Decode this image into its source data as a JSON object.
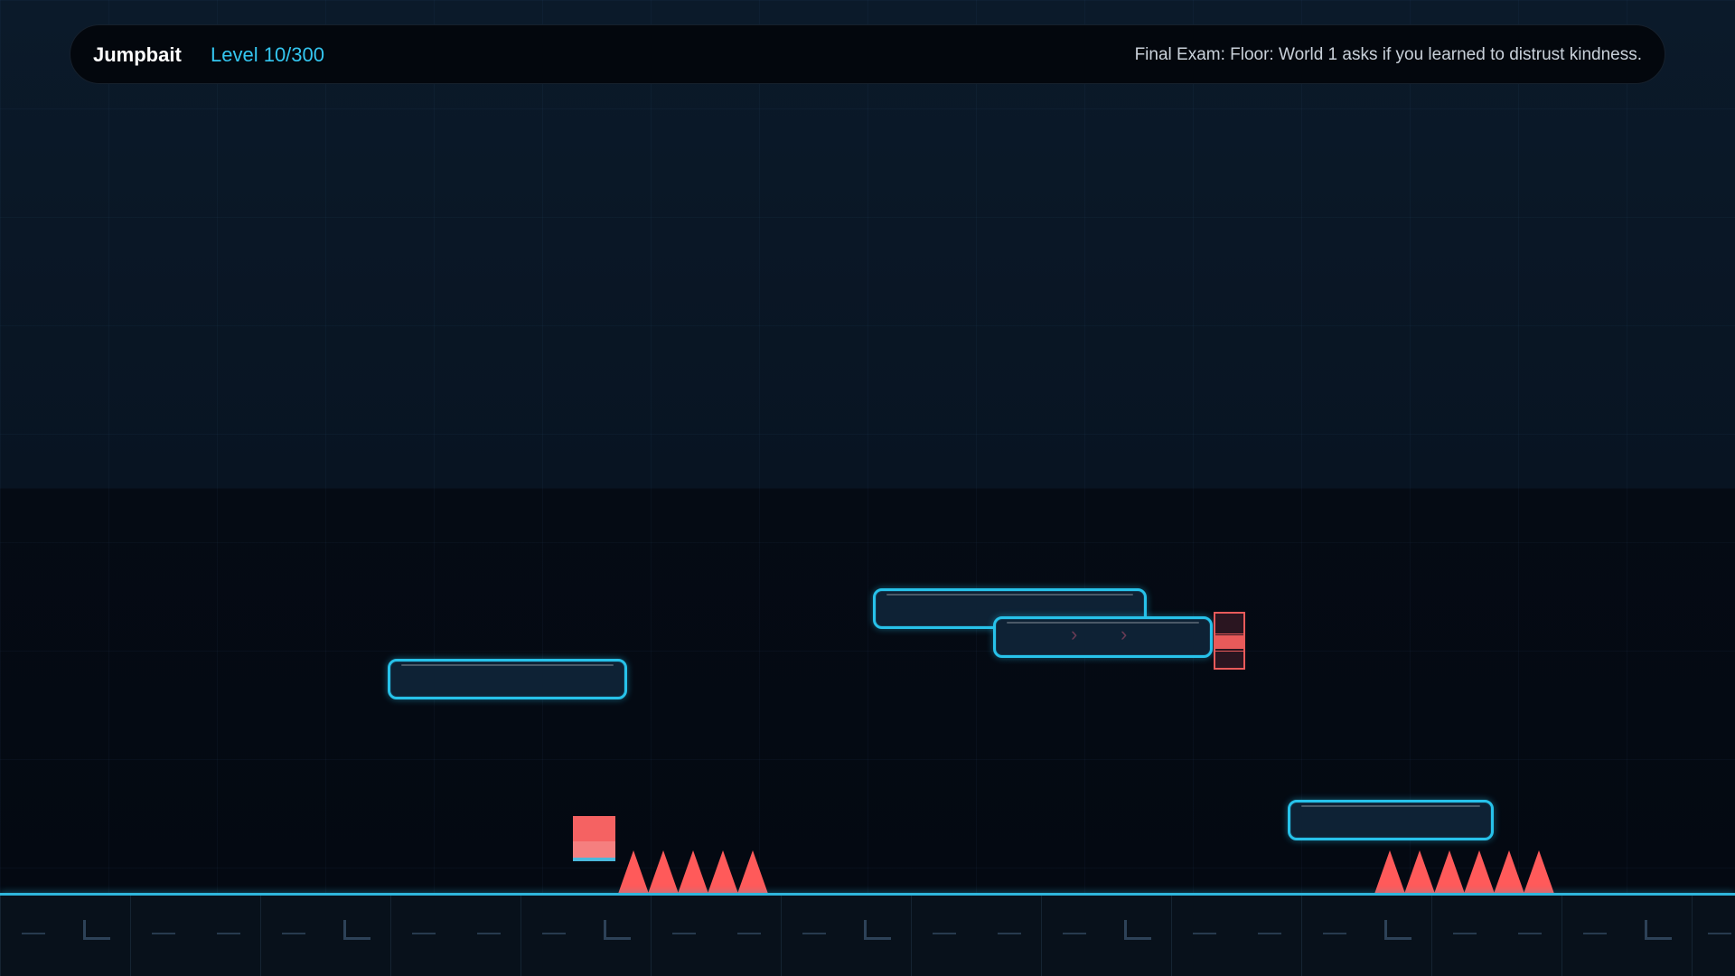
{
  "hud": {
    "title": "Jumpbait",
    "level": "Level 10/300",
    "hint": "Final Exam: Floor: World 1 asks if you learned to distrust kindness."
  },
  "colors": {
    "accent": "#27c2ea",
    "hazard": "#ff5a5a",
    "player": "#f56262",
    "background": "#050a12"
  },
  "platforms": [
    {
      "name": "platform-left",
      "moving": false
    },
    {
      "name": "platform-upper",
      "moving": false
    },
    {
      "name": "platform-moving",
      "moving": true,
      "arrows": [
        "›",
        "›"
      ]
    },
    {
      "name": "platform-right",
      "moving": false
    }
  ],
  "spike_groups": [
    {
      "name": "spikes-left",
      "count": 5
    },
    {
      "name": "spikes-right",
      "count": 6
    }
  ]
}
